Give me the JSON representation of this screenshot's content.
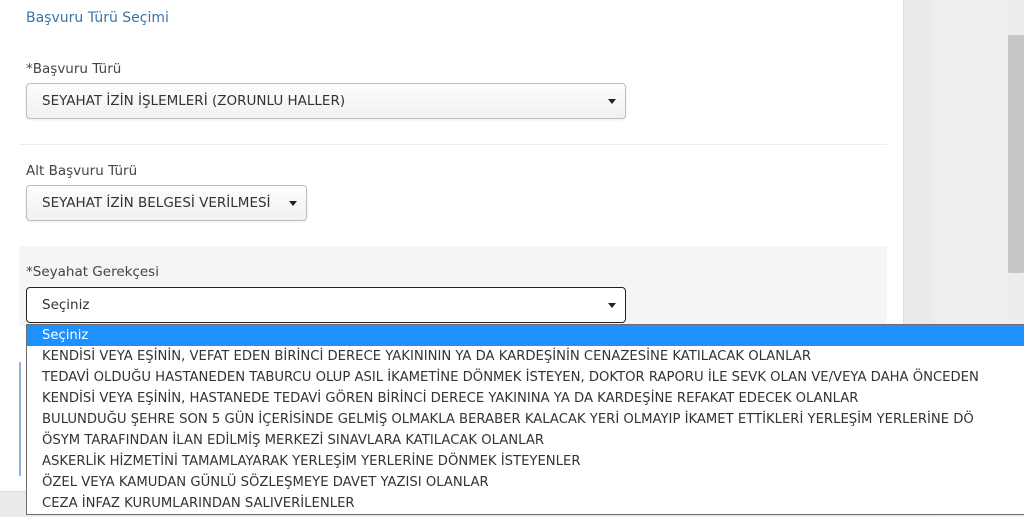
{
  "form": {
    "section_title": "Başvuru Türü Seçimi",
    "basvuru_turu": {
      "label": "*Başvuru Türü",
      "value": "SEYAHAT İZİN İŞLEMLERİ (ZORUNLU HALLER)"
    },
    "alt_basvuru_turu": {
      "label": "Alt Başvuru Türü",
      "value": "SEYAHAT İZİN BELGESİ VERİLMESİ"
    },
    "seyahat_gerekcesi": {
      "label": "*Seyahat Gerekçesi",
      "value": "Seçiniz",
      "options": [
        "Seçiniz",
        "KENDİSİ VEYA EŞİNİN, VEFAT EDEN BİRİNCİ DERECE YAKINININ YA DA KARDEŞİNİN CENAZESİNE KATILACAK OLANLAR",
        "TEDAVİ OLDUĞU HASTANEDEN TABURCU OLUP ASIL İKAMETİNE DÖNMEK İSTEYEN, DOKTOR RAPORU İLE SEVK OLAN VE/VEYA DAHA ÖNCEDEN",
        "KENDİSİ VEYA EŞİNİN, HASTANEDE TEDAVİ GÖREN BİRİNCİ DERECE YAKININA YA DA KARDEŞİNE REFAKAT EDECEK OLANLAR",
        "BULUNDUĞU ŞEHRE SON 5 GÜN İÇERİSİNDE GELMİŞ OLMAKLA BERABER KALACAK YERİ OLMAYIP İKAMET ETTİKLERİ YERLEŞİM YERLERİNE DÖ",
        "ÖSYM TARAFINDAN İLAN EDİLMİŞ MERKEZİ SINAVLARA KATILACAK OLANLAR",
        "ASKERLİK HİZMETİNİ TAMAMLAYARAK YERLEŞİM YERLERİNE DÖNMEK İSTEYENLER",
        "ÖZEL VEYA KAMUDAN GÜNLÜ SÖZLEŞMEYE DAVET YAZISI OLANLAR",
        "CEZA İNFAZ KURUMLARINDAN SALIVERİLENLER"
      ]
    }
  }
}
